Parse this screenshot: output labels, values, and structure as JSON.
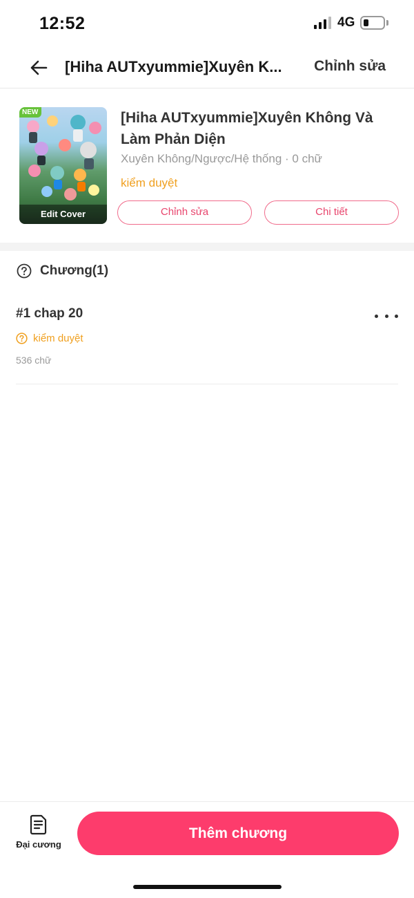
{
  "status_bar": {
    "time": "12:52",
    "network": "4G",
    "battery_level": 0.25
  },
  "nav": {
    "title": "[Hiha AUTxyummie]Xuyên K...",
    "action_label": "Chỉnh sửa"
  },
  "book": {
    "cover_badge": "NEW",
    "cover_edit_label": "Edit Cover",
    "title": "[Hiha AUTxyummie]Xuyên Không Và Làm Phản Diện",
    "meta": "Xuyên Không/Ngược/Hệ thống · 0 chữ",
    "status": "kiểm duyệt",
    "edit_button": "Chỉnh sửa",
    "detail_button": "Chi tiết"
  },
  "chapters": {
    "header": "Chương(1)",
    "items": [
      {
        "title": "#1 chap 20",
        "status": "kiểm duyệt",
        "words": "536 chữ"
      }
    ]
  },
  "bottom": {
    "outline_label": "Đại cương",
    "add_chapter_label": "Thêm chương"
  },
  "colors": {
    "accent": "#fd3c6c",
    "pending": "#f0a020",
    "outline_border": "#f06a8a"
  }
}
